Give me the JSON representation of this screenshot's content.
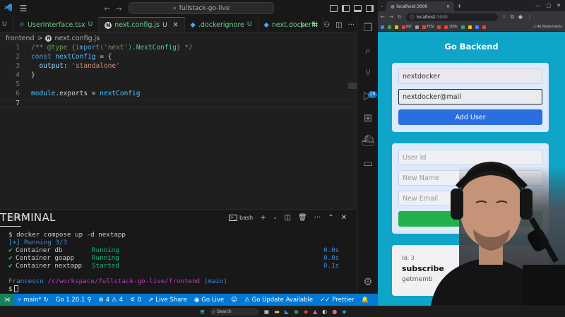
{
  "vscode": {
    "title_search": "fullstack-go-live",
    "tabs": [
      {
        "label": "U",
        "status": "",
        "icon": "ts"
      },
      {
        "label": "UserInterface.tsx",
        "status": "U",
        "icon": "react"
      },
      {
        "label": "next.config.js",
        "status": "U",
        "icon": "next",
        "active": true
      },
      {
        "label": ".dockerignore",
        "status": "U",
        "icon": "docker"
      },
      {
        "label": "next.dockerfil",
        "status": "",
        "icon": "docker"
      }
    ],
    "breadcrumb": {
      "folder": "frontend",
      "sep": ">",
      "file": "next.config.js"
    },
    "code_lines": [
      {
        "n": "1"
      },
      {
        "n": "2"
      },
      {
        "n": "3"
      },
      {
        "n": "4"
      },
      {
        "n": "5"
      },
      {
        "n": "6"
      },
      {
        "n": "7"
      }
    ],
    "code": {
      "l1_a": "/** @type {",
      "l1_b": "import",
      "l1_c": "('next').",
      "l1_d": "NextConfig",
      "l1_e": "} */",
      "l2_a": "const",
      "l2_b": " nextConfig",
      "l2_c": " = {",
      "l3_a": "  output",
      "l3_b": ": ",
      "l3_c": "'standalone'",
      "l4": "}",
      "l6_a": "module",
      "l6_b": ".exports = ",
      "l6_c": "nextConfig"
    },
    "panel": {
      "tabs": [
        "TERMINAL",
        "PORTS"
      ],
      "shell": "bash",
      "terminal": {
        "cmd": "$ docker compose up -d nextapp",
        "running": "[+] Running 3/3",
        "rows": [
          {
            "check": "✔",
            "name": "Container db",
            "state": "Running",
            "time": "0.0s"
          },
          {
            "check": "✔",
            "name": "Container goapp",
            "state": "Running",
            "time": "0.0s"
          },
          {
            "check": "✔",
            "name": "Container nextapp",
            "state": "Started",
            "time": "0.1s"
          }
        ],
        "prompt_user": "Francesco",
        "prompt_path": "/c/workspace/fullstack-go-live/frontend",
        "prompt_branch": "(main)",
        "prompt_symbol": "$"
      }
    },
    "activity_badge": "29",
    "statusbar": {
      "branch": "main*",
      "go_version": "Go 1.20.1",
      "errors": "4",
      "warnings": "4",
      "ports": "0",
      "live_share": "Live Share",
      "go_live": "Go Live",
      "go_update": "Go Update Available",
      "prettier": "Prettier"
    }
  },
  "browser": {
    "tab_title": "localhost:3000",
    "url_host": "localhost",
    "url_port": ":3000",
    "bookmarks": [
      "ND",
      "TESI",
      "100k"
    ],
    "all_bookmarks": "All Bookmarks",
    "page": {
      "title": "Go Backend",
      "create_form": {
        "name_value": "nextdocker",
        "email_value": "nextdocker@mail",
        "button": "Add User"
      },
      "update_form": {
        "user_id_placeholder": "User Id",
        "new_name_placeholder": "New Name",
        "new_email_placeholder": "New Email",
        "button": "Up"
      },
      "user_card": {
        "id_label": "Id: 3",
        "name": "subscribe",
        "email": "getmemb"
      }
    }
  },
  "taskbar": {
    "search_placeholder": "Search"
  },
  "colors": {
    "vscode_bg": "#1f1f1f",
    "statusbar": "#0078d4",
    "page_bg": "#0ea5c9",
    "add_button": "#2a6fe0",
    "update_button": "#22b24b"
  }
}
